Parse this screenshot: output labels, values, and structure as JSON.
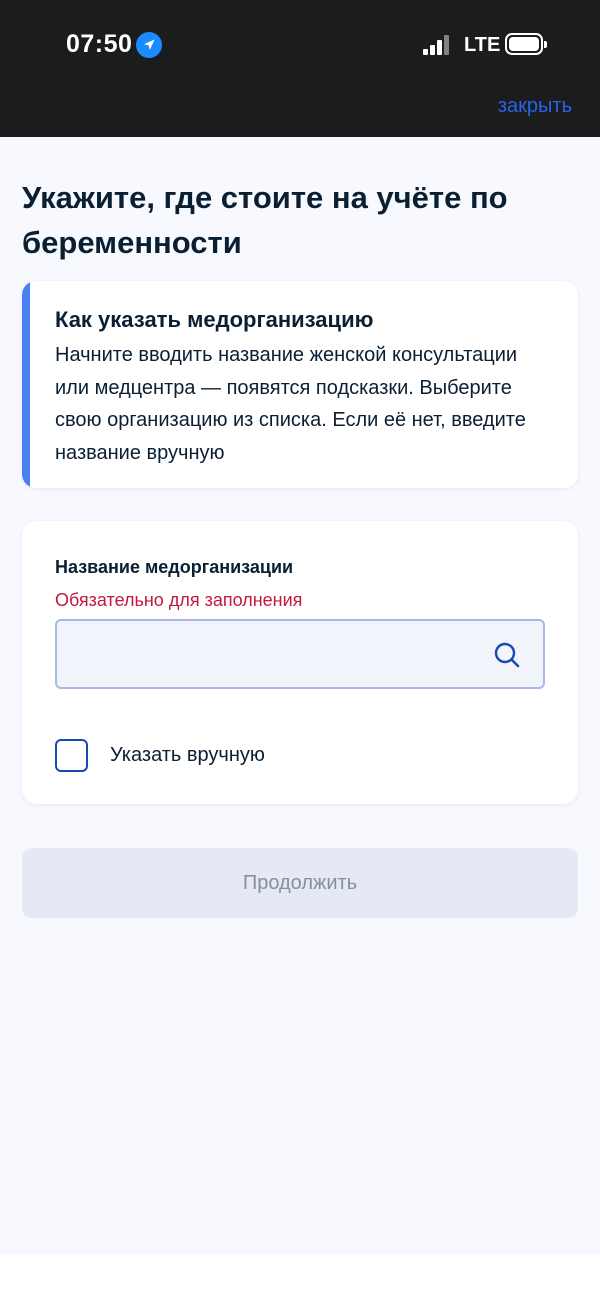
{
  "status_bar": {
    "time": "07:50",
    "network": "LTE",
    "location_icon": "location-arrow-icon",
    "signal_icon": "cellular-signal-icon",
    "battery_icon": "battery-full-icon"
  },
  "header": {
    "close_label": "закрыть"
  },
  "page": {
    "title": "Укажите, где стоите на учёте по беременности"
  },
  "info": {
    "title": "Как указать медорганизацию",
    "text": "Начните вводить название женской консультации или медцентра — появятся подсказки. Выберите свою организацию из списка. Если её нет, введите название вручную"
  },
  "form": {
    "field_label": "Название медорганизации",
    "field_error": "Обязательно для заполнения",
    "field_value": "",
    "field_placeholder": "",
    "search_icon": "search-icon",
    "manual_checkbox_label": "Указать вручную",
    "manual_checked": false
  },
  "actions": {
    "continue_label": "Продолжить"
  },
  "colors": {
    "accent": "#4a7ff0",
    "link": "#2a63e8",
    "error": "#c4183c",
    "checkbox_border": "#1b47b3",
    "background": "#f7f9fe"
  }
}
